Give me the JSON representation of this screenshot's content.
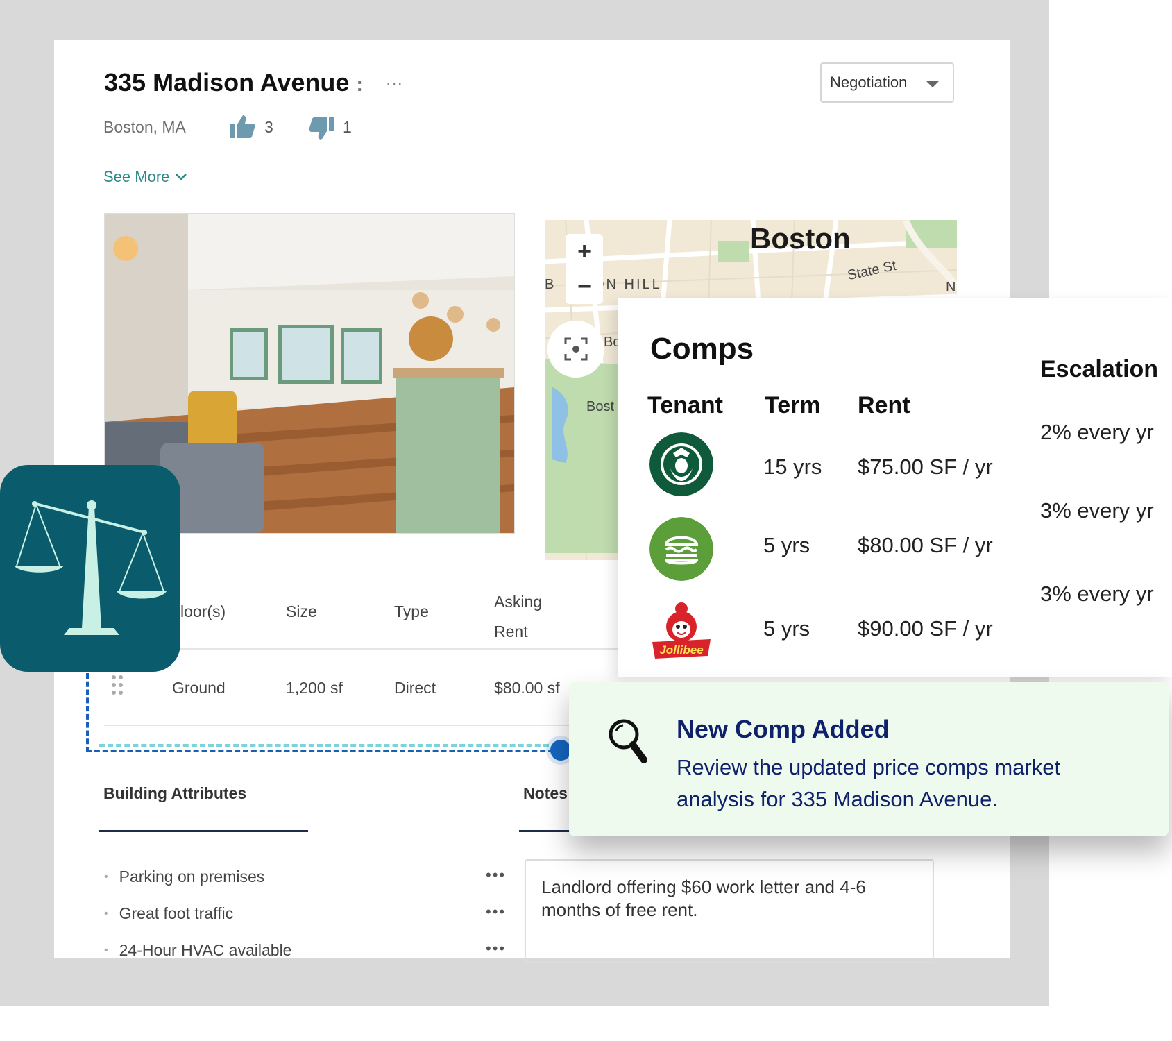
{
  "property": {
    "title": "335 Madison Avenue",
    "title_overflow_glyph": ":",
    "more_icon": "…",
    "location": "Boston, MA",
    "likes": "3",
    "dislikes": "1",
    "see_more": "See More",
    "stage": "Negotiation"
  },
  "map": {
    "city_label": "Boston",
    "neighborhood_label_a": "B",
    "neighborhood_label_b": "ON HILL",
    "street_label": "State St",
    "edge_label": "N",
    "side_label_a": "Bo",
    "side_label_b": "Bost",
    "zoom_in": "+",
    "zoom_out": "−"
  },
  "spaces": {
    "headers": {
      "floor": "loor(s)",
      "size": "Size",
      "type": "Type",
      "rent_line1": "Asking",
      "rent_line2": "Rent"
    },
    "rows": [
      {
        "floor": "Ground",
        "size": "1,200 sf",
        "type": "Direct",
        "rent": "$80.00 sf"
      }
    ]
  },
  "attributes": {
    "title": "Building Attributes",
    "items": [
      "Parking on premises",
      "Great foot traffic",
      "24-Hour HVAC available"
    ],
    "item_menu": "•••"
  },
  "notes": {
    "title": "Notes",
    "text": "Landlord offering $60 work letter and 4-6 months of free rent."
  },
  "comps": {
    "title": "Comps",
    "headers": {
      "tenant": "Tenant",
      "term": "Term",
      "rent": "Rent",
      "escalation": "Escalation"
    },
    "rows": [
      {
        "tenant_logo": "starbucks-logo",
        "term": "15 yrs",
        "rent": "$75.00 SF / yr",
        "escalation": "2% every yr"
      },
      {
        "tenant_logo": "burger-logo",
        "term": "5 yrs",
        "rent": "$80.00 SF / yr",
        "escalation": "3% every yr"
      },
      {
        "tenant_logo": "jollibee-logo",
        "term": "5 yrs",
        "rent": "$90.00 SF / yr",
        "escalation": "3% every yr"
      }
    ],
    "jollibee_wordmark": "Jollibee"
  },
  "toast": {
    "title": "New Comp Added",
    "body": "Review the updated price comps market analysis for 335 Madison Avenue."
  },
  "colors": {
    "accent_teal": "#2c8a86",
    "app_icon_bg": "#0a5c6d",
    "toast_bg": "#eefaee",
    "toast_text": "#10216b",
    "connector_blue": "#1a5fb4"
  },
  "icons": {
    "app": "scales-icon",
    "like": "thumbs-up-icon",
    "dislike": "thumbs-down-icon",
    "search": "magnifier-icon",
    "map_recenter": "recenter-icon",
    "drag": "drag-handle-icon"
  }
}
